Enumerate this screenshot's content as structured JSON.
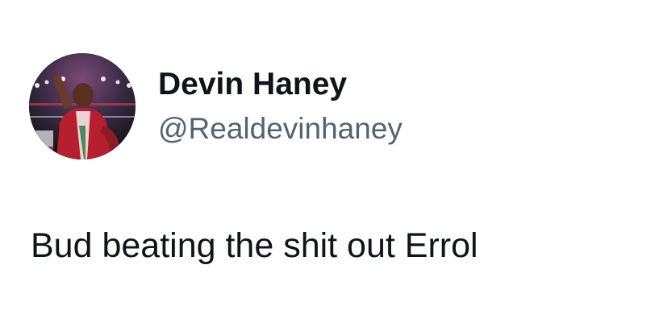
{
  "tweet": {
    "author": {
      "display_name": "Devin Haney",
      "handle": "@Realdevinhaney",
      "avatar_icon": "boxer-photo-avatar"
    },
    "text": "Bud beating the shit out Errol"
  },
  "colors": {
    "text_primary": "#0f1419",
    "text_secondary": "#536471",
    "background": "#ffffff"
  }
}
